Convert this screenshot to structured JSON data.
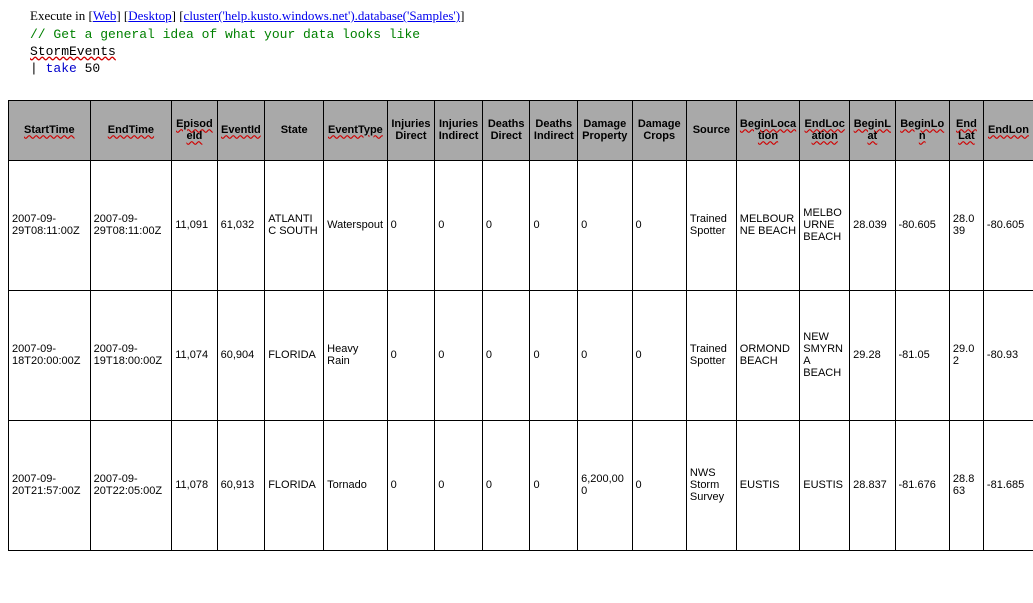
{
  "exec": {
    "label": "Execute in",
    "web": "Web",
    "desktop": "Desktop",
    "cluster": "cluster('help.kusto.windows.net').database('Samples')"
  },
  "code": {
    "comment": "// Get a general idea of what your data looks like",
    "line1": "StormEvents",
    "pipe": "| ",
    "take": "take",
    "num": " 50"
  },
  "headers": {
    "StartTime": "StartTime",
    "EndTime": "EndTime",
    "EpisodeId": "EpisodeId",
    "EventId": "EventId",
    "State": "State",
    "EventType": "EventType",
    "InjuriesDirect": "Injuries Direct",
    "InjuriesIndirect": "Injuries Indirect",
    "DeathsDirect": "Deaths Direct",
    "DeathsIndirect": "Deaths Indirect",
    "DamageProperty": "Damage Property",
    "DamageCrops": "Damage Crops",
    "Source": "Source",
    "BeginLocation": "BeginLocation",
    "EndLocation": "EndLocation",
    "BeginLat": "BeginLat",
    "BeginLon": "BeginLon",
    "EndLat": "EndLat",
    "EndLon": "EndLon"
  },
  "rows": [
    {
      "StartTime": "2007-09-29T08:11:00Z",
      "EndTime": "2007-09-29T08:11:00Z",
      "EpisodeId": "11,091",
      "EventId": "61,032",
      "State": "ATLANTIC SOUTH",
      "EventType": "Waterspout",
      "InjuriesDirect": "0",
      "InjuriesIndirect": "0",
      "DeathsDirect": "0",
      "DeathsIndirect": "0",
      "DamageProperty": "0",
      "DamageCrops": "0",
      "Source": "Trained Spotter",
      "BeginLocation": "MELBOURNE BEACH",
      "EndLocation": "MELBOURNE BEACH",
      "BeginLat": "28.039",
      "BeginLon": "-80.605",
      "EndLat": "28.039",
      "EndLon": "-80.605"
    },
    {
      "StartTime": "2007-09-18T20:00:00Z",
      "EndTime": "2007-09-19T18:00:00Z",
      "EpisodeId": "11,074",
      "EventId": "60,904",
      "State": "FLORIDA",
      "EventType": "Heavy Rain",
      "InjuriesDirect": "0",
      "InjuriesIndirect": "0",
      "DeathsDirect": "0",
      "DeathsIndirect": "0",
      "DamageProperty": "0",
      "DamageCrops": "0",
      "Source": "Trained Spotter",
      "BeginLocation": "ORMOND BEACH",
      "EndLocation": "NEW SMYRNA BEACH",
      "BeginLat": "29.28",
      "BeginLon": "-81.05",
      "EndLat": "29.02",
      "EndLon": "-80.93"
    },
    {
      "StartTime": "2007-09-20T21:57:00Z",
      "EndTime": "2007-09-20T22:05:00Z",
      "EpisodeId": "11,078",
      "EventId": "60,913",
      "State": "FLORIDA",
      "EventType": "Tornado",
      "InjuriesDirect": "0",
      "InjuriesIndirect": "0",
      "DeathsDirect": "0",
      "DeathsIndirect": "0",
      "DamageProperty": "6,200,000",
      "DamageCrops": "0",
      "Source": "NWS Storm Survey",
      "BeginLocation": "EUSTIS",
      "EndLocation": "EUSTIS",
      "BeginLat": "28.837",
      "BeginLon": "-81.676",
      "EndLat": "28.863",
      "EndLon": "-81.685"
    }
  ]
}
